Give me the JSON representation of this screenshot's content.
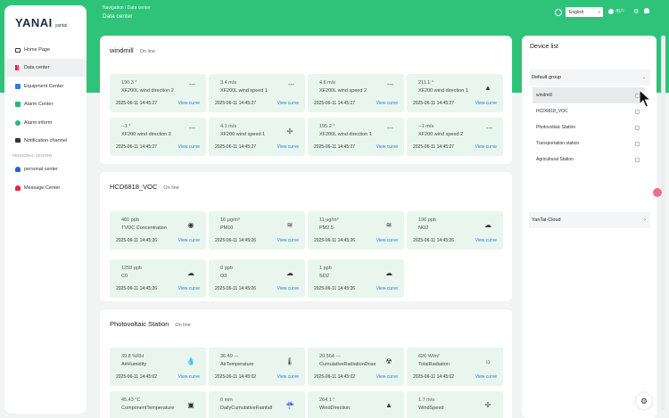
{
  "brand": {
    "name": "YANAI",
    "sub": "yantai"
  },
  "sidebar": {
    "items": [
      {
        "label": "Home Page",
        "icon": "monitor-icon"
      },
      {
        "label": "Data center",
        "icon": "bar-chart-icon"
      },
      {
        "label": "Equipment Center",
        "icon": "device-icon"
      },
      {
        "label": "Alarm Center",
        "icon": "alarm-icon"
      },
      {
        "label": "Alarm inform",
        "icon": "alarm-inform-icon"
      },
      {
        "label": "Notification channel",
        "icon": "mail-icon"
      }
    ],
    "section_label": "PERSONAL CENTER",
    "personal_items": [
      {
        "label": "personal center",
        "icon": "person-icon"
      },
      {
        "label": "Message Center",
        "icon": "bell-icon"
      }
    ]
  },
  "header": {
    "breadcrumb": "Navigation  /  Data center",
    "title": "Data center",
    "language": "English",
    "user": "用户"
  },
  "sections": [
    {
      "title": "windmill",
      "status": "On line",
      "cards": [
        {
          "value": "190.3 °",
          "name": "XF200L wind direction 2",
          "time": "2025-06-11 14:45:27",
          "link": "View curve",
          "icon": "---"
        },
        {
          "value": "3.4 m/s",
          "name": "XF200L wind speed 1",
          "time": "2025-06-11 14:45:27",
          "link": "View curve",
          "icon": "---"
        },
        {
          "value": "4.6 m/s",
          "name": "XF200L wind speed 2",
          "time": "2025-06-11 14:45:27",
          "link": "View curve",
          "icon": "---"
        },
        {
          "value": "211.1 °",
          "name": "XF200 wind direction 1",
          "time": "2025-06-11 14:45:27",
          "link": "View curve",
          "icon": "navigation-icon"
        },
        {
          "value": "--1 °",
          "name": "XF200 wind direction 2",
          "time": "2025-06-11 14:45:27",
          "link": "View curve",
          "icon": "---"
        },
        {
          "value": "4.1 m/s",
          "name": "XF200 wind speed 1",
          "time": "2025-06-11 14:45:27",
          "link": "View curve",
          "icon": "fan-icon"
        },
        {
          "value": "195.2 °",
          "name": "XF200L wind direction 1",
          "time": "2025-06-11 14:45:27",
          "link": "View curve",
          "icon": "---"
        },
        {
          "value": "--1 m/s",
          "name": "XF200 wind speed 2",
          "time": "2025-06-11 14:45:27",
          "link": "View curve",
          "icon": "---"
        }
      ]
    },
    {
      "title": "HCD6818_VOC",
      "status": "On line",
      "cards": [
        {
          "value": "401 ppb",
          "name": "TVOC Concentration",
          "time": "2025-06-11 14:45:26",
          "link": "View curve",
          "icon": "gauge-icon"
        },
        {
          "value": "16 μg/m³",
          "name": "PM10",
          "time": "2025-06-11 14:45:26",
          "link": "View curve",
          "icon": "haze-icon"
        },
        {
          "value": "11 μg/m³",
          "name": "PM2.5",
          "time": "2025-06-11 14:45:26",
          "link": "View curve",
          "icon": "haze-icon"
        },
        {
          "value": "196 ppb",
          "name": "NO2",
          "time": "2025-06-11 14:45:26",
          "link": "View curve",
          "icon": "cloud-icon"
        },
        {
          "value": "1259 ppb",
          "name": "C0",
          "time": "2025-06-11 14:45:26",
          "link": "View curve",
          "icon": "cloud-icon"
        },
        {
          "value": "0 ppb",
          "name": "O3",
          "time": "2025-06-11 14:45:26",
          "link": "View curve",
          "icon": "cloud-icon"
        },
        {
          "value": "1 ppb",
          "name": "SO2",
          "time": "2025-06-11 14:45:26",
          "link": "View curve",
          "icon": "cloud-icon"
        }
      ]
    },
    {
      "title": "Photovoltaic Station",
      "status": "On line",
      "cards": [
        {
          "value": "39.8 %RH",
          "name": "AirHumidity",
          "time": "2025-06-11 14:45:02",
          "link": "View curve",
          "icon": "humidity-icon"
        },
        {
          "value": "36.49 ---",
          "name": "AirTemperature",
          "time": "2025-06-11 14:45:02",
          "link": "View curve",
          "icon": "thermometer-icon"
        },
        {
          "value": "20.564 ---",
          "name": "CumulativeRadiationDose",
          "time": "2025-06-11 14:45:02",
          "link": "View curve",
          "icon": "radiation-icon"
        },
        {
          "value": "626 W/m²",
          "name": "TotalRadiation",
          "time": "2025-06-11 14:45:02",
          "link": "View curve",
          "icon": "sun-cloud-icon"
        },
        {
          "value": "45.43 °C",
          "name": "ComponentTemperature",
          "time": "",
          "link": "",
          "icon": "panel-icon"
        },
        {
          "value": "0 mm",
          "name": "DailyCumulativeRainfall",
          "time": "",
          "link": "",
          "icon": "rain-icon"
        },
        {
          "value": "264.1 °",
          "name": "WindDirection",
          "time": "",
          "link": "",
          "icon": "navigation-icon"
        },
        {
          "value": "1.7 m/s",
          "name": "WindSpeed",
          "time": "",
          "link": "",
          "icon": "fan-icon"
        }
      ]
    }
  ],
  "device_list": {
    "title": "Device list",
    "groups": [
      {
        "label": "Default group",
        "expanded": true,
        "items": [
          "windmill",
          "HCD6818_VOC",
          "Photovoltaic Station",
          "Transportation station",
          "Agricultural Station"
        ],
        "selected": "windmill"
      },
      {
        "label": "YanTai-Cloud",
        "expanded": false
      }
    ]
  },
  "colors": {
    "accent": "#2fc37a",
    "card_bg": "#e8f6ee",
    "link": "#2e7be0"
  }
}
